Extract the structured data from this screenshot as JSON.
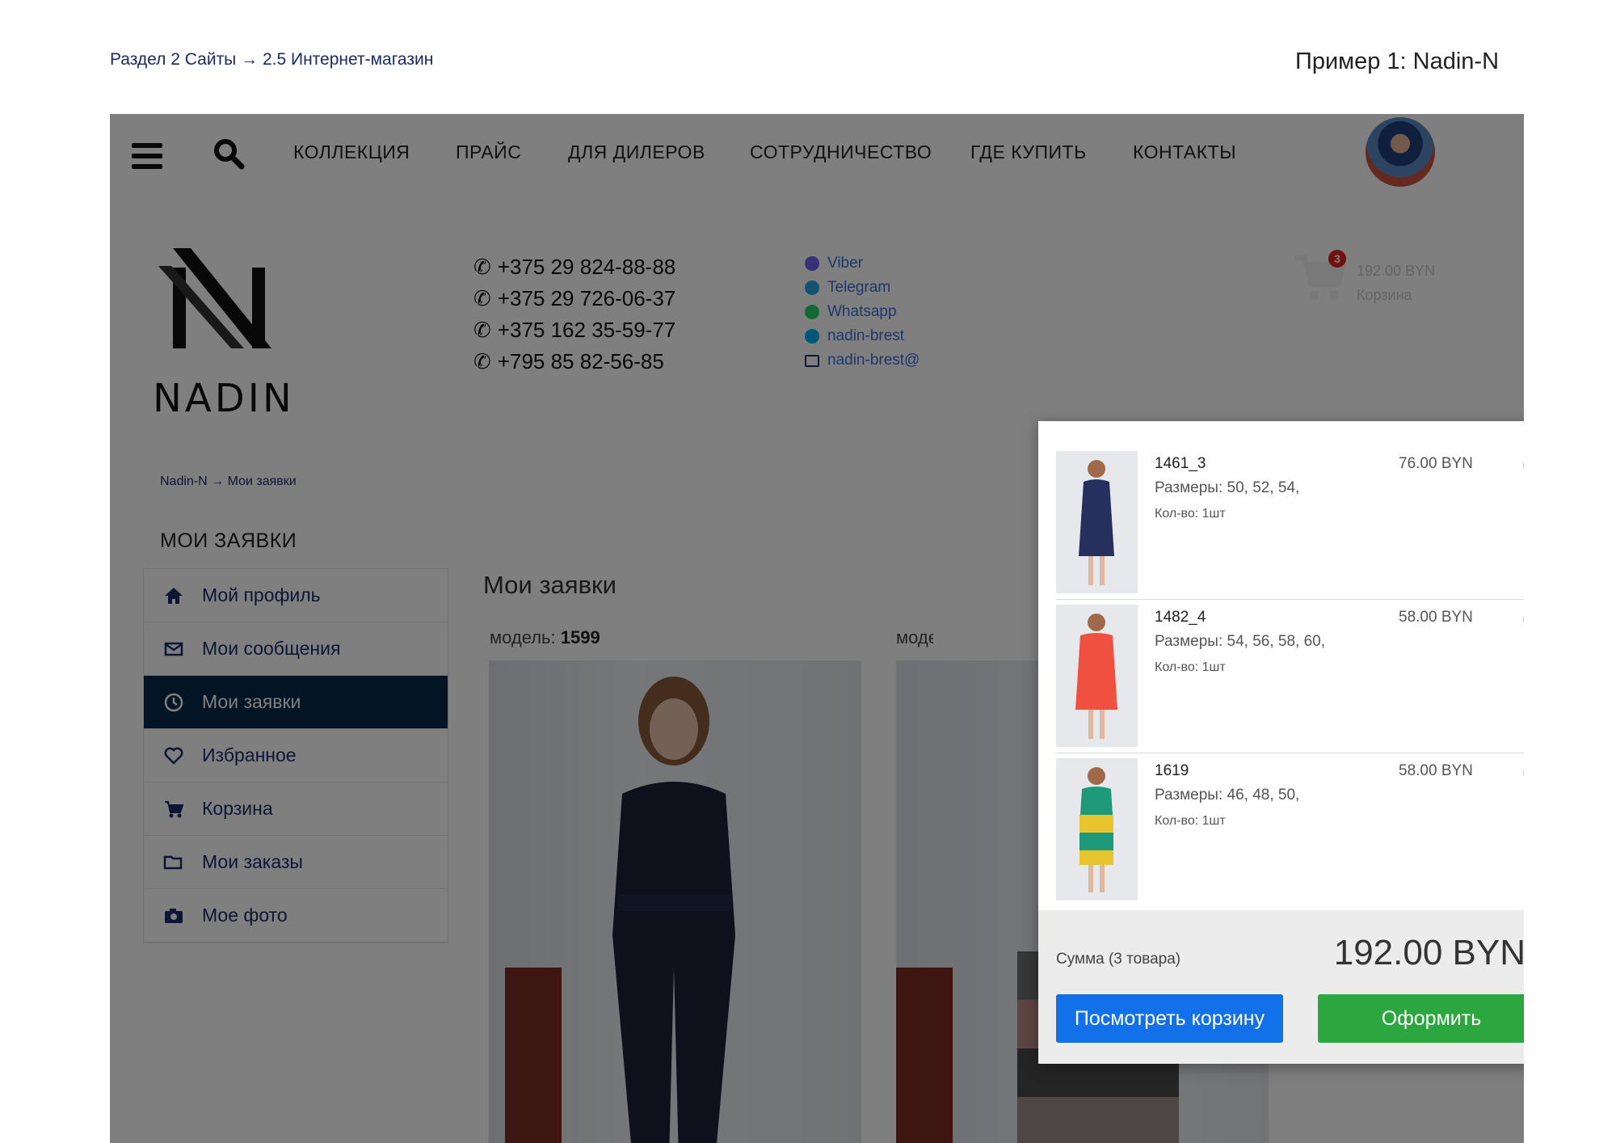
{
  "slide": {
    "section": "Раздел 2 Сайты  → 2.5 Интернет-магазин",
    "example": "Пример 1: Nadin-N"
  },
  "nav": {
    "items": [
      "КОЛЛЕКЦИЯ",
      "ПРАЙС",
      "ДЛЯ ДИЛЕРОВ",
      "СОТРУДНИЧЕСТВО",
      "ГДЕ КУПИТЬ",
      "КОНТАКТЫ"
    ]
  },
  "logo": {
    "text": "NADIN"
  },
  "phones": [
    "+375 29 824-88-88",
    "+375 29 726-06-37",
    "+375 162 35-59-77",
    "+795 85 82-56-85"
  ],
  "messengers": [
    {
      "label": "Viber",
      "color": "#7360f2"
    },
    {
      "label": "Telegram",
      "color": "#2aa3e0"
    },
    {
      "label": "Whatsapp",
      "color": "#25d366"
    },
    {
      "label": "nadin-brest",
      "color": "#00aff0"
    },
    {
      "label": "nadin-brest@",
      "color": "#1a2b6b"
    }
  ],
  "cart_widget": {
    "count": "3",
    "sum": "192.00 BYN",
    "label": "Корзина"
  },
  "breadcrumb": "Nadin-N → Мои заявки",
  "sidebar": {
    "title": "МОИ ЗАЯВКИ",
    "items": [
      {
        "label": "Мой профиль",
        "icon": "home-icon"
      },
      {
        "label": "Мои сообщения",
        "icon": "envelope-icon"
      },
      {
        "label": "Мои заявки",
        "icon": "clock-icon",
        "active": true
      },
      {
        "label": "Избранное",
        "icon": "heart-icon"
      },
      {
        "label": "Корзина",
        "icon": "cart-icon"
      },
      {
        "label": "Мои заказы",
        "icon": "folder-icon"
      },
      {
        "label": "Мое фото",
        "icon": "camera-icon"
      }
    ]
  },
  "content": {
    "title": "Мои заявки",
    "model_label": "модель:",
    "model_number": "1599",
    "model2_label": "модель:"
  },
  "dropdown": {
    "items": [
      {
        "name": "1461_3",
        "sizes": "Размеры: 50, 52, 54,",
        "qty": "Кол-во: 1шт",
        "price": "76.00 BYN",
        "dress_color": "#26305e"
      },
      {
        "name": "1482_4",
        "sizes": "Размеры: 54, 56, 58, 60,",
        "qty": "Кол-во: 1шт",
        "price": "58.00 BYN",
        "dress_color": "#f0503f"
      },
      {
        "name": "1619",
        "sizes": "Размеры: 46, 48, 50,",
        "qty": "Кол-во: 1шт",
        "price": "58.00 BYN",
        "dress_color": "#1e9a7a"
      }
    ],
    "sum_label": "Сумма (3 товара)",
    "sum_value": "192.00 BYN",
    "view_button": "Посмотреть корзину",
    "order_button": "Оформить"
  },
  "colors": {
    "accent_blue": "#1270e8",
    "accent_green": "#2ca63f",
    "active_sidebar": "#062b4a",
    "link": "#1a2b6b"
  }
}
